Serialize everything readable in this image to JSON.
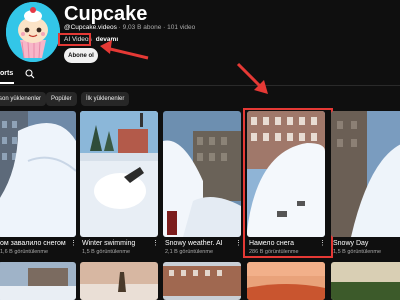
{
  "channel": {
    "name": "Cupcake",
    "handle": "@Cupcake.videos",
    "meta_rest": " · 9,03 B abone · 101 video",
    "description": "AI Videos",
    "more_label": "devamı",
    "subscribe_label": "Abone ol"
  },
  "tabs": {
    "videos_label": "orts",
    "search_icon": "search-icon"
  },
  "chips": [
    {
      "label": "son yüklenenler"
    },
    {
      "label": "Popüler"
    },
    {
      "label": "İlk yüklenenler"
    }
  ],
  "videos": [
    {
      "title": "ом завалило снегом",
      "views": "1,6 B görüntülenme"
    },
    {
      "title": "Winter swimming",
      "views": "1,5 B görüntülenme"
    },
    {
      "title": "Snowy weather. AI",
      "views": "2,1 B görüntülenme"
    },
    {
      "title": "Намело снега",
      "views": "286 B görüntülenme"
    },
    {
      "title": "Snowy Day",
      "views": "1,5 B görüntülenme"
    }
  ],
  "colors": {
    "background": "#0f0f0f",
    "highlight": "#e53935",
    "chip_bg": "#272727"
  }
}
